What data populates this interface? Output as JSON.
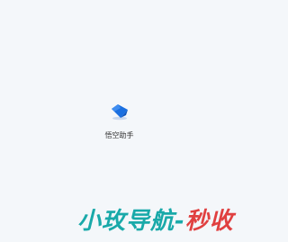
{
  "app": {
    "name": "悟空助手",
    "logo_icon": "blue-gem-logo-icon",
    "accent_color": "#1a6fe0"
  },
  "watermark": {
    "text_main": "小玫导航-",
    "text_tail": "秒收",
    "color_main": "#19a9a9",
    "color_tail": "#e04040"
  }
}
